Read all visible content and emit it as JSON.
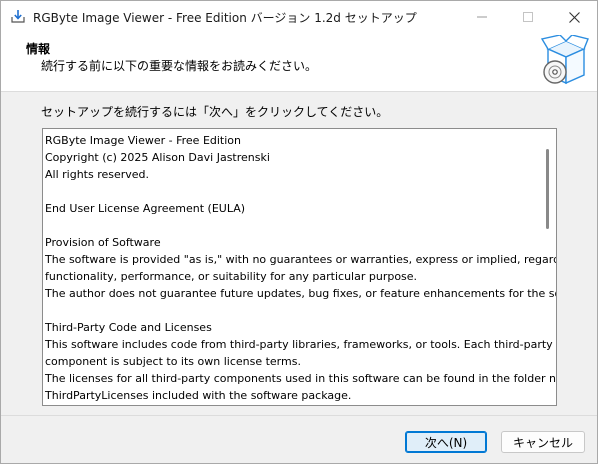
{
  "window": {
    "title": "RGByte Image Viewer - Free Edition バージョン 1.2d セットアップ"
  },
  "header": {
    "title": "情報",
    "subtitle": "続行する前に以下の重要な情報をお読みください。"
  },
  "body": {
    "instruction": "セットアップを続行するには「次へ」をクリックしてください。",
    "license_lines": [
      "RGByte Image Viewer - Free Edition",
      "Copyright (c) 2025 Alison Davi Jastrenski",
      "All rights reserved.",
      "",
      "End User License Agreement (EULA)",
      "",
      "Provision of Software",
      "The software is provided \"as is,\" with no guarantees or warranties, express or implied, regarding its",
      "functionality, performance, or suitability for any particular purpose.",
      "The author does not guarantee future updates, bug fixes, or feature enhancements for the software.",
      "",
      "Third-Party Code and Licenses",
      "This software includes code from third-party libraries, frameworks, or tools. Each third-party",
      "component is subject to its own license terms.",
      "The licenses for all third-party components used in this software can be found in the folder named",
      "ThirdPartyLicenses included with the software package."
    ]
  },
  "buttons": {
    "next": "次へ(N)",
    "cancel": "キャンセル"
  },
  "icons": {
    "app": "installer-icon",
    "header": "software-box-disc-icon"
  }
}
